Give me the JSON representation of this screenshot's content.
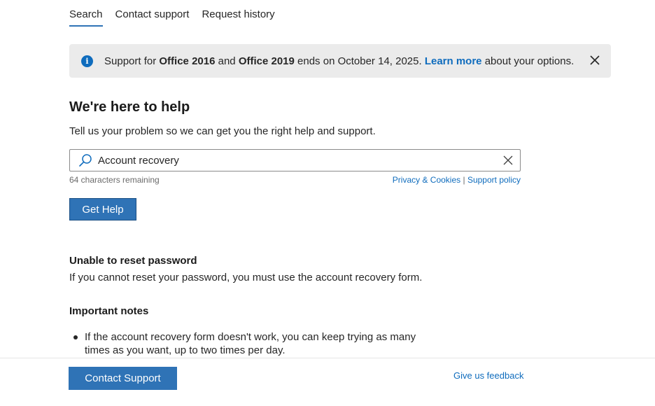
{
  "tabs": [
    {
      "label": "Search",
      "active": true
    },
    {
      "label": "Contact support",
      "active": false
    },
    {
      "label": "Request history",
      "active": false
    }
  ],
  "banner": {
    "text_1": "Support for ",
    "bold_1": "Office 2016",
    "text_2": " and ",
    "bold_2": "Office 2019",
    "text_3": " ends on October 14, 2025. ",
    "link": "Learn more",
    "text_4": " about your options.",
    "icon": "info-icon",
    "close_icon": "close-icon"
  },
  "help": {
    "title": "We're here to help",
    "subtitle": "Tell us your problem so we can get you the right help and support."
  },
  "search": {
    "value": "Account recovery",
    "remaining": "64 characters remaining",
    "privacy_link": "Privacy & Cookies",
    "separator": " | ",
    "policy_link": "Support policy",
    "button": "Get Help"
  },
  "result": {
    "title": "Unable to reset password",
    "text": "If you cannot reset your password, you must use the account recovery form.",
    "notes_title": "Important notes",
    "notes": [
      "If the account recovery form doesn't work, you can keep trying as many times as you want, up to two times per day."
    ]
  },
  "footer": {
    "contact_button": "Contact Support",
    "feedback_link": "Give us feedback"
  },
  "colors": {
    "accent": "#2f73b6",
    "link": "#0f6cbd",
    "banner_bg": "#ebebeb"
  }
}
